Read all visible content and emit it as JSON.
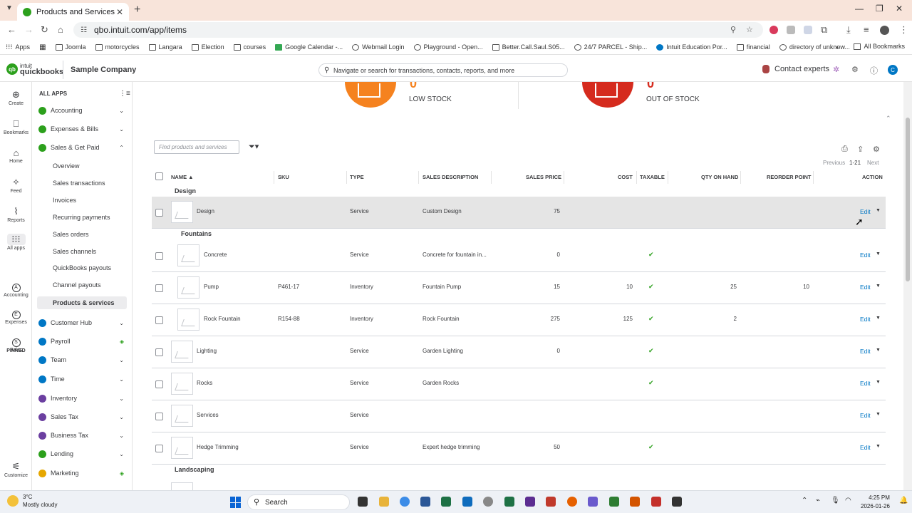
{
  "browser": {
    "tab_title": "Products and Services",
    "url": "qbo.intuit.com/app/items",
    "bookmarks": [
      "Apps",
      "Joomla",
      "motorcycles",
      "Langara",
      "Election",
      "courses",
      "Google Calendar -...",
      "Webmail Login",
      "Playground - Open...",
      "Better.Call.Saul.S05...",
      "24/7 PARCEL - Ship...",
      "Intuit Education Por...",
      "financial",
      "directory of unknow..."
    ],
    "all_bookmarks": "All Bookmarks"
  },
  "header": {
    "brand_top": "intuit",
    "brand_bottom": "quickbooks",
    "company": "Sample Company",
    "search_placeholder": "Navigate or search for transactions, contacts, reports, and more",
    "contact": "Contact experts",
    "user_initial": "C"
  },
  "rail": {
    "create": "Create",
    "bookmarks": "Bookmarks",
    "home": "Home",
    "feed": "Feed",
    "reports": "Reports",
    "all_apps": "All apps",
    "pinned": "PINNED",
    "accounting": "Accounting",
    "expenses": "Expenses",
    "sales": "Sales",
    "customize": "Customize"
  },
  "sidebar": {
    "all_apps": "ALL APPS",
    "items": {
      "accounting": "Accounting",
      "expenses": "Expenses & Bills",
      "sales": "Sales & Get Paid",
      "customer_hub": "Customer Hub",
      "payroll": "Payroll",
      "team": "Team",
      "time": "Time",
      "inventory": "Inventory",
      "sales_tax": "Sales Tax",
      "business_tax": "Business Tax",
      "lending": "Lending",
      "marketing": "Marketing"
    },
    "sub": {
      "overview": "Overview",
      "sales_transactions": "Sales transactions",
      "invoices": "Invoices",
      "recurring": "Recurring payments",
      "sales_orders": "Sales orders",
      "sales_channels": "Sales channels",
      "qb_payouts": "QuickBooks payouts",
      "channel_payouts": "Channel payouts",
      "products": "Products & services"
    }
  },
  "stock": {
    "low_value": "0",
    "low_label": "LOW STOCK",
    "out_value": "0",
    "out_label": "OUT OF STOCK"
  },
  "toolbar": {
    "find_placeholder": "Find products and services",
    "previous": "Previous",
    "range": "1-21",
    "next": "Next"
  },
  "table": {
    "headers": {
      "name": "NAME ▲",
      "sku": "SKU",
      "type": "TYPE",
      "desc": "SALES DESCRIPTION",
      "price": "SALES PRICE",
      "cost": "COST",
      "taxable": "TAXABLE",
      "qty": "QTY ON HAND",
      "reorder": "REORDER POINT",
      "action": "ACTION"
    },
    "groups": {
      "design": "Design",
      "fountains": "Fountains",
      "landscaping": "Landscaping"
    },
    "edit_label": "Edit",
    "rows": [
      {
        "name": "Design",
        "sku": "",
        "type": "Service",
        "desc": "Custom Design",
        "price": "75",
        "cost": "",
        "taxable": "",
        "qty": "",
        "reorder": ""
      },
      {
        "name": "Concrete",
        "sku": "",
        "type": "Service",
        "desc": "Concrete for fountain in...",
        "price": "0",
        "cost": "",
        "taxable": "✔",
        "qty": "",
        "reorder": ""
      },
      {
        "name": "Pump",
        "sku": "P461-17",
        "type": "Inventory",
        "desc": "Fountain Pump",
        "price": "15",
        "cost": "10",
        "taxable": "✔",
        "qty": "25",
        "reorder": "10"
      },
      {
        "name": "Rock Fountain",
        "sku": "R154-88",
        "type": "Inventory",
        "desc": "Rock Fountain",
        "price": "275",
        "cost": "125",
        "taxable": "✔",
        "qty": "2",
        "reorder": ""
      },
      {
        "name": "Lighting",
        "sku": "",
        "type": "Service",
        "desc": "Garden Lighting",
        "price": "0",
        "cost": "",
        "taxable": "✔",
        "qty": "",
        "reorder": ""
      },
      {
        "name": "Rocks",
        "sku": "",
        "type": "Service",
        "desc": "Garden Rocks",
        "price": "",
        "cost": "",
        "taxable": "✔",
        "qty": "",
        "reorder": ""
      },
      {
        "name": "Services",
        "sku": "",
        "type": "Service",
        "desc": "",
        "price": "",
        "cost": "",
        "taxable": "",
        "qty": "",
        "reorder": ""
      },
      {
        "name": "Hedge Trimming",
        "sku": "",
        "type": "Service",
        "desc": "Expert hedge trimming",
        "price": "50",
        "cost": "",
        "taxable": "✔",
        "qty": "",
        "reorder": ""
      }
    ]
  },
  "taskbar": {
    "temp": "3°C",
    "weather": "Mostly cloudy",
    "search": "Search",
    "time": "4:25 PM",
    "date": "2026-01-26"
  }
}
